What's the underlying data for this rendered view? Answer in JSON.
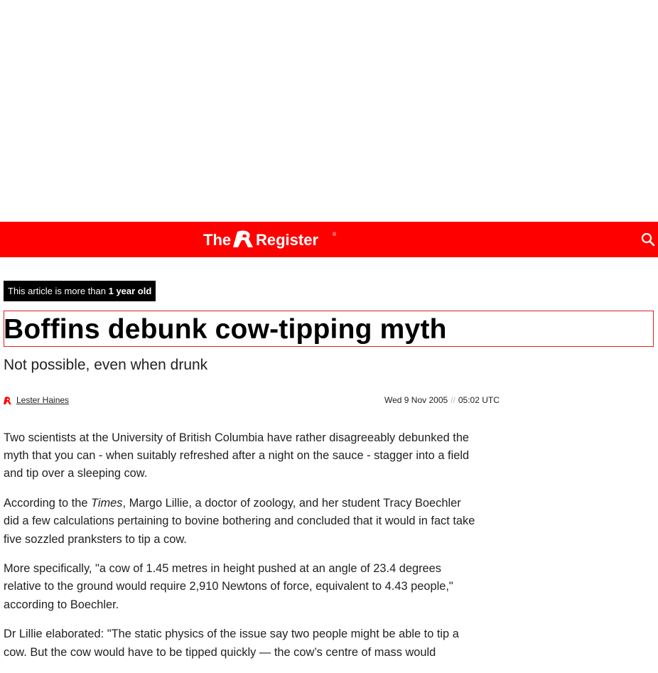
{
  "site": {
    "logo_text": "The Register"
  },
  "notice": {
    "prefix": "This article is more than ",
    "age": "1 year old"
  },
  "article": {
    "headline": "Boffins debunk cow-tipping myth",
    "standfirst": "Not possible, even when drunk",
    "author": "Lester Haines",
    "date": "Wed 9 Nov 2005",
    "date_sep": "//",
    "time": "05:02 UTC",
    "paragraphs": [
      "Two scientists at the University of British Columbia have rather disagreeably debunked the myth that you can - when suitably refreshed after a night on the sauce - stagger into a field and tip over a sleeping cow.",
      "did a few calculations pertaining to bovine bothering and concluded that it would in fact take five sozzled pranksters to tip a cow.",
      "More specifically, \"a cow of 1.45 metres in height pushed at an angle of 23.4 degrees relative to the ground would require 2,910 Newtons of force, equivalent to 4.43 people,\" according to Boechler.",
      "Dr Lillie elaborated: \"The static physics of the issue say two people might be able to tip a cow. But the cow would have to be tipped quickly — the cow’s centre of mass would"
    ],
    "p2_lead": "According to the ",
    "p2_em": "Times",
    "p2_rest": ", Margo Lillie, a doctor of zoology, and her student Tracy Boechler "
  },
  "colors": {
    "brand_red": "#ff0000",
    "border_red": "#dd2222",
    "badge_bg": "#000000"
  },
  "icons": {
    "search": "search-icon",
    "author": "register-r-icon"
  }
}
